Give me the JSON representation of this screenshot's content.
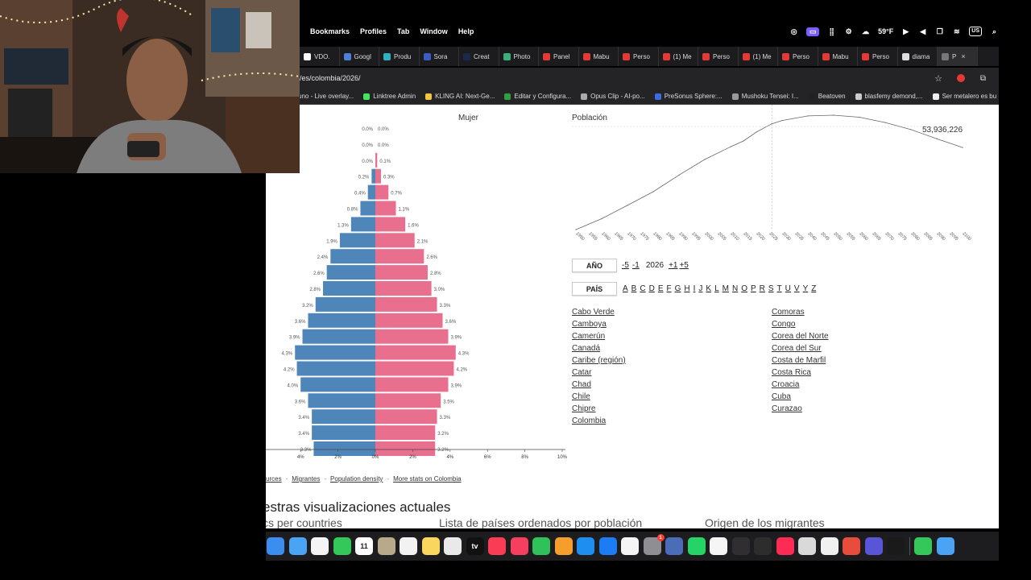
{
  "menubar": {
    "items": [
      "Bookmarks",
      "Profiles",
      "Tab",
      "Window",
      "Help"
    ],
    "weather": "59°F",
    "input_lang": "US"
  },
  "tabs": [
    {
      "label": "VDO.",
      "color": "#ffffff"
    },
    {
      "label": "Googl",
      "color": "#4f7fd9"
    },
    {
      "label": "Produ",
      "color": "#2bb3c0"
    },
    {
      "label": "Sora",
      "color": "#3b5cc4"
    },
    {
      "label": "Creat",
      "color": "#1b2a4a"
    },
    {
      "label": "Photo",
      "color": "#38b27a"
    },
    {
      "label": "Panel",
      "color": "#e53935"
    },
    {
      "label": "Mabu",
      "color": "#e53935"
    },
    {
      "label": "Perso",
      "color": "#e53935"
    },
    {
      "label": "(1) Me",
      "color": "#e53935"
    },
    {
      "label": "Perso",
      "color": "#e53935"
    },
    {
      "label": "(1) Me",
      "color": "#e53935"
    },
    {
      "label": "Perso",
      "color": "#e53935"
    },
    {
      "label": "Mabu",
      "color": "#e53935"
    },
    {
      "label": "Perso",
      "color": "#e53935"
    },
    {
      "label": "diama",
      "color": "#dddddd"
    },
    {
      "label": "P",
      "color": "#777777"
    }
  ],
  "address": {
    "url": "/es/colombia/2026/"
  },
  "bookmarks": [
    {
      "label": "uno - Live overlay...",
      "color": "#555555"
    },
    {
      "label": "Linktree Admin",
      "color": "#43e55e"
    },
    {
      "label": "KLING AI: Next-Ge...",
      "color": "#f5c342"
    },
    {
      "label": "Editar y Configura...",
      "color": "#2f9e44"
    },
    {
      "label": "Opus Clip - AI-po...",
      "color": "#aaaaaa"
    },
    {
      "label": "PreSonus Sphere:...",
      "color": "#3a6de0"
    },
    {
      "label": "Mushoku Tensei: I...",
      "color": "#999999"
    },
    {
      "label": "Beatoven",
      "color": "#222222"
    },
    {
      "label": "blasfemy demond,...",
      "color": "#cccccc"
    },
    {
      "label": "Ser metalero es bu",
      "color": "#eeeeee"
    }
  ],
  "pyramid": {
    "title": "Mujer",
    "axis_ticks": [
      "%",
      "4%",
      "2%",
      "0%",
      "2%",
      "4%",
      "6%",
      "8%",
      "10%"
    ],
    "male_color": "#4f86ba",
    "female_color": "#e8708e",
    "male": [
      0.0,
      0.0,
      0.0,
      0.2,
      0.4,
      0.8,
      1.3,
      1.9,
      2.4,
      2.6,
      2.8,
      3.2,
      3.6,
      3.9,
      4.3,
      4.2,
      4.0,
      3.6,
      3.4,
      3.4,
      3.3
    ],
    "female": [
      0.0,
      0.0,
      0.1,
      0.3,
      0.7,
      1.1,
      1.6,
      2.1,
      2.6,
      2.8,
      3.0,
      3.3,
      3.6,
      3.9,
      4.3,
      4.2,
      3.9,
      3.5,
      3.3,
      3.2,
      3.2
    ],
    "male_labels": [
      "0.0%",
      "0.0%",
      "0.0%",
      "0.2%",
      "0.4%",
      "0.8%",
      "1.3%",
      "1.9%",
      "2.4%",
      "2.6%",
      "2.8%",
      "3.2%",
      "3.6%",
      "3.9%",
      "4.3%",
      "4.2%",
      "4.0%",
      "3.6%",
      "3.4%",
      "3.4%",
      "3.3%"
    ],
    "female_labels": [
      "0.0%",
      "0.0%",
      "0.1%",
      "0.3%",
      "0.7%",
      "1.1%",
      "1.6%",
      "2.1%",
      "2.6%",
      "2.8%",
      "3.0%",
      "3.3%",
      "3.6%",
      "3.9%",
      "4.3%",
      "4.2%",
      "3.9%",
      "3.5%",
      "3.3%",
      "3.2%",
      "3.2%"
    ]
  },
  "chart_data": {
    "type": "line",
    "title": "Población",
    "current_value": "53,936,226",
    "current_year": 2026,
    "x_ticks": [
      "1950",
      "1955",
      "1960",
      "1965",
      "1970",
      "1975",
      "1980",
      "1985",
      "1990",
      "1995",
      "2000",
      "2005",
      "2010",
      "2015",
      "2020",
      "2025",
      "2030",
      "2035",
      "2040",
      "2045",
      "2050",
      "2055",
      "2060",
      "2065",
      "2070",
      "2075",
      "2080",
      "2085",
      "2090",
      "2095",
      "2100"
    ],
    "x": [
      1950,
      1960,
      1970,
      1980,
      1990,
      2000,
      2010,
      2015,
      2020,
      2026,
      2030,
      2040,
      2050,
      2060,
      2070,
      2080,
      2090,
      2100
    ],
    "y": [
      12.0,
      16.3,
      21.6,
      27.0,
      33.6,
      39.8,
      44.8,
      47.1,
      50.6,
      53.9,
      55.2,
      57.0,
      57.3,
      56.5,
      54.4,
      51.6,
      48.0,
      44.5
    ]
  },
  "controls": {
    "year_label": "AÑO",
    "year_links": [
      "-5",
      "-1"
    ],
    "year_current": "2026",
    "year_links_after": [
      "+1",
      "+5"
    ],
    "country_label": "PAÍS",
    "letters": [
      "A",
      "B",
      "C",
      "D",
      "E",
      "F",
      "G",
      "H",
      "I",
      "J",
      "K",
      "L",
      "M",
      "N",
      "O",
      "P",
      "R",
      "S",
      "T",
      "U",
      "V",
      "Y",
      "Z"
    ]
  },
  "countries": {
    "col1": [
      "Cabo Verde",
      "Camboya",
      "Camerún",
      "Canadá",
      "Caribe (región)",
      "Catar",
      "Chad",
      "Chile",
      "Chipre",
      "Colombia"
    ],
    "col2": [
      "Comoras",
      "Congo",
      "Corea del Norte",
      "Corea del Sur",
      "Costa de Marfil",
      "Costa Rica",
      "Croacia",
      "Cuba",
      "Curazao"
    ]
  },
  "links": [
    "urces",
    "Migrantes",
    "Population density",
    "More stats on Colombia"
  ],
  "headline": "estras visualizaciones actuales",
  "subheads": [
    "cs per countries",
    "Lista de países ordenados por población",
    "Origen de los migrantes"
  ],
  "dock": [
    {
      "name": "mail-app",
      "color": "#3b8ef0"
    },
    {
      "name": "safari-app",
      "color": "#4aa3f5"
    },
    {
      "name": "photos-app",
      "color": "#f5f5f5"
    },
    {
      "name": "facetime-app",
      "color": "#34c759"
    },
    {
      "name": "calendar-app",
      "color": "#ffffff",
      "text": "11"
    },
    {
      "name": "contacts-app",
      "color": "#b8a98a"
    },
    {
      "name": "reminders-app",
      "color": "#f2f2f2"
    },
    {
      "name": "notes-app",
      "color": "#f9d75e"
    },
    {
      "name": "freeform-app",
      "color": "#e9e9e9"
    },
    {
      "name": "tv-app",
      "color": "#111111",
      "text": "tv"
    },
    {
      "name": "music-app",
      "color": "#fa3c55"
    },
    {
      "name": "news-app",
      "color": "#f43f5e"
    },
    {
      "name": "numbers-app",
      "color": "#30c25a"
    },
    {
      "name": "pages-app",
      "color": "#f59e2b"
    },
    {
      "name": "keynote-app",
      "color": "#1f8ef1"
    },
    {
      "name": "appstore-app",
      "color": "#1c7cf3"
    },
    {
      "name": "capcut-app",
      "color": "#f5f5f5"
    },
    {
      "name": "settings-app",
      "color": "#8e8e93",
      "badge": "1"
    },
    {
      "name": "simulator-app",
      "color": "#4b6cb7"
    },
    {
      "name": "whatsapp-app",
      "color": "#25d366"
    },
    {
      "name": "chrome-app",
      "color": "#f5f5f5"
    },
    {
      "name": "obs-app",
      "color": "#302e31"
    },
    {
      "name": "finalcut-app",
      "color": "#2d2d2d"
    },
    {
      "name": "tiktok-app",
      "color": "#fe2c55"
    },
    {
      "name": "logic-app",
      "color": "#d9d9d9"
    },
    {
      "name": "chatgpt-app",
      "color": "#f0f0f0"
    },
    {
      "name": "game-app",
      "color": "#e74c3c"
    },
    {
      "name": "launchpad-app",
      "color": "#5856d6"
    },
    {
      "name": "waves-app",
      "color": "#1a1a1a"
    },
    {
      "name": "phone-app",
      "color": "#34c759"
    },
    {
      "name": "safari2-app",
      "color": "#4aa3f5"
    }
  ]
}
